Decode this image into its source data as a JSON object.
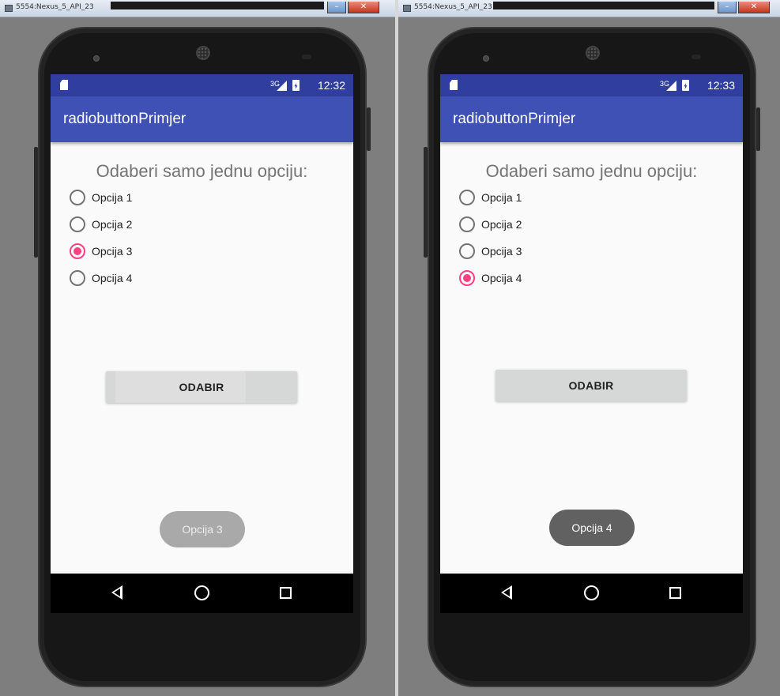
{
  "colors": {
    "primary": "#3f51b5",
    "primary_dark": "#303f9f",
    "accent": "#ff4081",
    "toast_fading": "#a9a9a9",
    "toast_solid": "#616161"
  },
  "windows": [
    {
      "title": "5554:Nexus_5_API_23",
      "status": {
        "network": "3G",
        "time": "12:32"
      },
      "app_title": "radiobuttonPrimjer",
      "heading": "Odaberi samo jednu opciju:",
      "options": [
        "Opcija 1",
        "Opcija 2",
        "Opcija 3",
        "Opcija 4"
      ],
      "selected_index": 2,
      "button_label": "ODABIR",
      "toast": "Opcija 3"
    },
    {
      "title": "5554:Nexus_5_API_23",
      "status": {
        "network": "3G",
        "time": "12:33"
      },
      "app_title": "radiobuttonPrimjer",
      "heading": "Odaberi samo jednu opciju:",
      "options": [
        "Opcija 1",
        "Opcija 2",
        "Opcija 3",
        "Opcija 4"
      ],
      "selected_index": 3,
      "button_label": "ODABIR",
      "toast": "Opcija 4"
    }
  ],
  "icons": {
    "status": [
      "sd-card-icon",
      "signal-3g-icon",
      "battery-charging-icon"
    ],
    "nav": [
      "back-icon",
      "home-icon",
      "recents-icon"
    ],
    "titlebar": [
      "app-icon",
      "minimize-icon",
      "close-icon"
    ]
  }
}
